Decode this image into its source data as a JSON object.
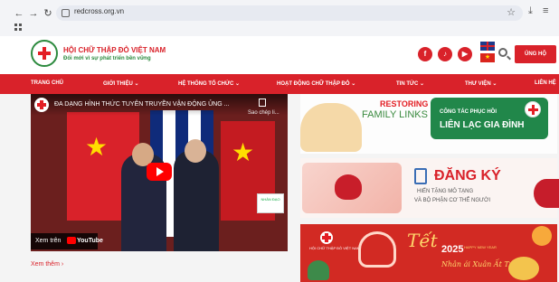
{
  "browser": {
    "url": "redcross.org.vn"
  },
  "header": {
    "org_name": "HỘI CHỮ THẬP ĐỎ VIỆT NAM",
    "slogan": "Đổi mới vì sự phát triển bền vững",
    "donate_label": "ỦNG HỘ",
    "social": {
      "facebook": "f",
      "tiktok": "♪",
      "youtube": "▶"
    },
    "flag_vn_glyph": "★"
  },
  "menu": {
    "items": [
      "TRANG CHỦ",
      "GIỚI THIỆU ⌄",
      "HỆ THỐNG TỔ CHỨC ⌄",
      "HOẠT ĐỘNG CHỮ THẬP ĐỎ ⌄",
      "TIN TỨC ⌄",
      "THƯ VIỆN ⌄",
      "LIÊN HỆ"
    ]
  },
  "video": {
    "title": "ĐA DẠNG HÌNH THỨC TUYÊN TRUYỀN VẬN ĐỘNG ỦNG ...",
    "copy_label": "Sao chép li...",
    "watch_on": "Xem trên",
    "youtube_word": "YouTube",
    "card_text": "NHÂN ĐẠO",
    "see_more": "Xem thêm  ›"
  },
  "banners": {
    "rfl_line1": "RESTORING",
    "rfl_line2": "FAMILY LINKS",
    "rfl_green_line1": "CÔNG TÁC PHỤC HỒI",
    "rfl_green_line2": "LIÊN LẠC GIA ĐÌNH",
    "register_title": "ĐĂNG KÝ",
    "register_sub1": "HIẾN TẶNG MÔ TẠNG",
    "register_sub2": "VÀ BỘ PHẬN CƠ THỂ NGƯỜI",
    "tet_org": "HỘI CHỮ THẬP ĐỎ VIỆT NAM",
    "tet_word": "Tết",
    "tet_year": "2025",
    "tet_hny": "HAPPY NEW YEAR",
    "tet_sub": "Nhân ái  Xuân Ất Tỵ"
  },
  "colors": {
    "brand_red": "#d9222a",
    "brand_green": "#2c8a3e"
  }
}
